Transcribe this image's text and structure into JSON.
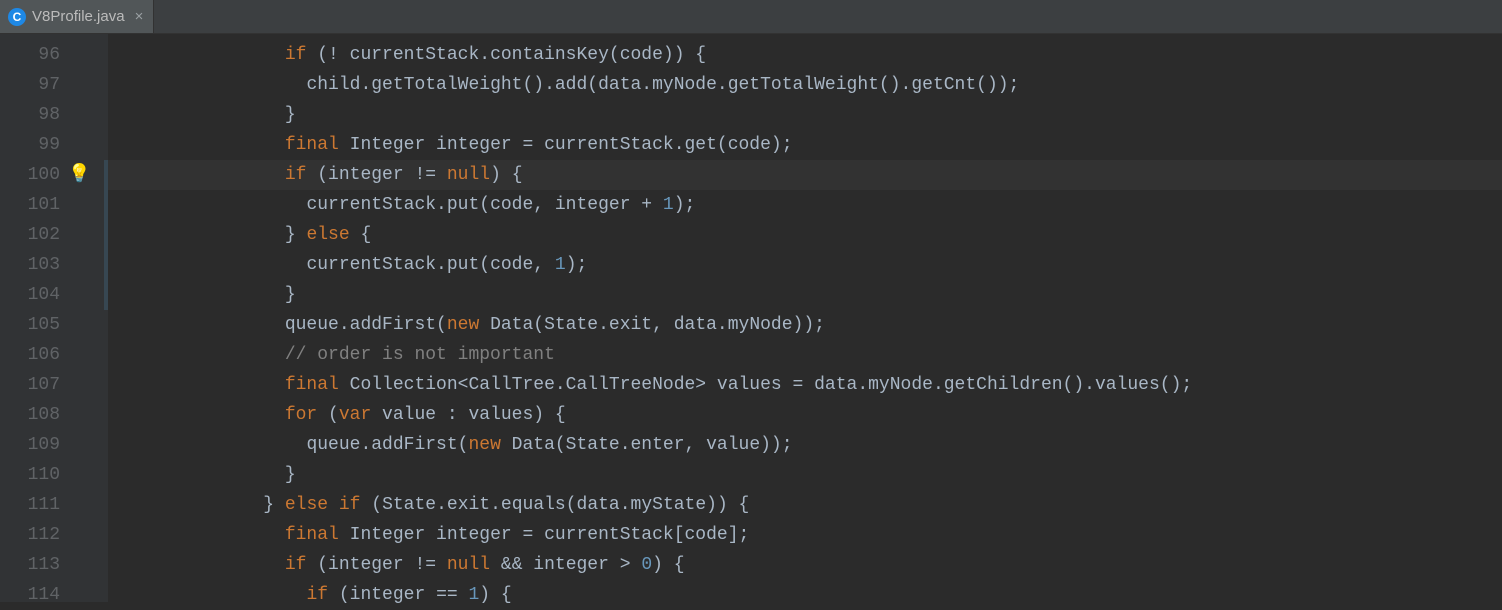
{
  "tab": {
    "icon_letter": "C",
    "filename": "V8Profile.java",
    "close_glyph": "×"
  },
  "bulb_glyph": "💡",
  "highlight_index": 4,
  "mod_strip": {
    "start": 4,
    "end": 8
  },
  "bulb_row": 4,
  "lines": [
    {
      "num": "96",
      "tokens": [
        [
          "sp",
          "                "
        ],
        [
          "kw",
          "if"
        ],
        [
          "punc",
          " (! currentStack.containsKey(code)) {"
        ]
      ]
    },
    {
      "num": "97",
      "tokens": [
        [
          "sp",
          "                  "
        ],
        [
          "id",
          "child.getTotalWeight().add(data.myNode.getTotalWeight().getCnt());"
        ]
      ]
    },
    {
      "num": "98",
      "tokens": [
        [
          "sp",
          "                "
        ],
        [
          "punc",
          "}"
        ]
      ]
    },
    {
      "num": "99",
      "tokens": [
        [
          "sp",
          "                "
        ],
        [
          "kw",
          "final"
        ],
        [
          "id",
          " Integer integer = currentStack.get(code);"
        ]
      ]
    },
    {
      "num": "100",
      "tokens": [
        [
          "sp",
          "                "
        ],
        [
          "kw",
          "if"
        ],
        [
          "id",
          " (integer != "
        ],
        [
          "kw",
          "null"
        ],
        [
          "punc",
          ") {"
        ]
      ]
    },
    {
      "num": "101",
      "tokens": [
        [
          "sp",
          "                  "
        ],
        [
          "id",
          "currentStack.put(code, integer + "
        ],
        [
          "num",
          "1"
        ],
        [
          "punc",
          ");"
        ]
      ]
    },
    {
      "num": "102",
      "tokens": [
        [
          "sp",
          "                "
        ],
        [
          "punc",
          "} "
        ],
        [
          "kw",
          "else"
        ],
        [
          "punc",
          " {"
        ]
      ]
    },
    {
      "num": "103",
      "tokens": [
        [
          "sp",
          "                  "
        ],
        [
          "id",
          "currentStack.put(code, "
        ],
        [
          "num",
          "1"
        ],
        [
          "punc",
          ");"
        ]
      ]
    },
    {
      "num": "104",
      "tokens": [
        [
          "sp",
          "                "
        ],
        [
          "punc",
          "}"
        ]
      ]
    },
    {
      "num": "105",
      "tokens": [
        [
          "sp",
          "                "
        ],
        [
          "id",
          "queue.addFirst("
        ],
        [
          "kw",
          "new"
        ],
        [
          "id",
          " Data(State."
        ],
        [
          "id",
          "exit"
        ],
        [
          "id",
          ", data.myNode));"
        ]
      ]
    },
    {
      "num": "106",
      "tokens": [
        [
          "sp",
          "                "
        ],
        [
          "cmt",
          "// order is not important"
        ]
      ]
    },
    {
      "num": "107",
      "tokens": [
        [
          "sp",
          "                "
        ],
        [
          "kw",
          "final"
        ],
        [
          "id",
          " Collection<CallTree.CallTreeNode> values = data.myNode.getChildren().values();"
        ]
      ]
    },
    {
      "num": "108",
      "tokens": [
        [
          "sp",
          "                "
        ],
        [
          "kw",
          "for"
        ],
        [
          "id",
          " ("
        ],
        [
          "kw",
          "var"
        ],
        [
          "id",
          " value : values) {"
        ]
      ]
    },
    {
      "num": "109",
      "tokens": [
        [
          "sp",
          "                  "
        ],
        [
          "id",
          "queue.addFirst("
        ],
        [
          "kw",
          "new"
        ],
        [
          "id",
          " Data(State."
        ],
        [
          "id",
          "enter"
        ],
        [
          "id",
          ", value));"
        ]
      ]
    },
    {
      "num": "110",
      "tokens": [
        [
          "sp",
          "                "
        ],
        [
          "punc",
          "}"
        ]
      ]
    },
    {
      "num": "111",
      "tokens": [
        [
          "sp",
          "              "
        ],
        [
          "punc",
          "} "
        ],
        [
          "kw",
          "else if"
        ],
        [
          "id",
          " (State."
        ],
        [
          "id",
          "exit"
        ],
        [
          "id",
          ".equals(data.myState)) {"
        ]
      ]
    },
    {
      "num": "112",
      "tokens": [
        [
          "sp",
          "                "
        ],
        [
          "kw",
          "final"
        ],
        [
          "id",
          " Integer integer = currentStack[code];"
        ]
      ]
    },
    {
      "num": "113",
      "tokens": [
        [
          "sp",
          "                "
        ],
        [
          "kw",
          "if"
        ],
        [
          "id",
          " (integer != "
        ],
        [
          "kw",
          "null"
        ],
        [
          "id",
          " && integer > "
        ],
        [
          "num",
          "0"
        ],
        [
          "punc",
          ") {"
        ]
      ]
    },
    {
      "num": "114",
      "tokens": [
        [
          "sp",
          "                  "
        ],
        [
          "kw",
          "if"
        ],
        [
          "id",
          " (integer == "
        ],
        [
          "num",
          "1"
        ],
        [
          "punc",
          ") {"
        ]
      ]
    }
  ]
}
